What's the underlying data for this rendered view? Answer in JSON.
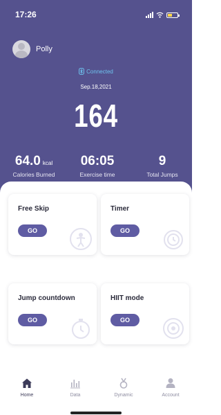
{
  "status_bar": {
    "time": "17:26"
  },
  "user": {
    "name": "Polly"
  },
  "device": {
    "status": "Connected",
    "status_color": "#6ec3ee"
  },
  "session": {
    "date": "Sep.18,2021",
    "jump_count": "164",
    "stats": [
      {
        "value": "64.0",
        "unit": "kcal",
        "label": "Calories Burned"
      },
      {
        "value": "06:05",
        "unit": "",
        "label": "Exercise time"
      },
      {
        "value": "9",
        "unit": "",
        "label": "Total Jumps"
      }
    ]
  },
  "modes": [
    {
      "title": "Free Skip",
      "button": "GO",
      "icon": "jumper-icon"
    },
    {
      "title": "Timer",
      "button": "GO",
      "icon": "clock-icon"
    },
    {
      "title": "Jump countdown",
      "button": "GO",
      "icon": "stopwatch-icon"
    },
    {
      "title": "HIIT mode",
      "button": "GO",
      "icon": "target-icon"
    }
  ],
  "tabs": [
    {
      "label": "Home",
      "icon": "home-icon",
      "active": true
    },
    {
      "label": "Data",
      "icon": "bar-chart-icon",
      "active": false
    },
    {
      "label": "Dynamic",
      "icon": "medal-icon",
      "active": false
    },
    {
      "label": "Account",
      "icon": "person-icon",
      "active": false
    }
  ],
  "colors": {
    "hero": "#55528e",
    "accent_button": "#5f5ca3"
  }
}
